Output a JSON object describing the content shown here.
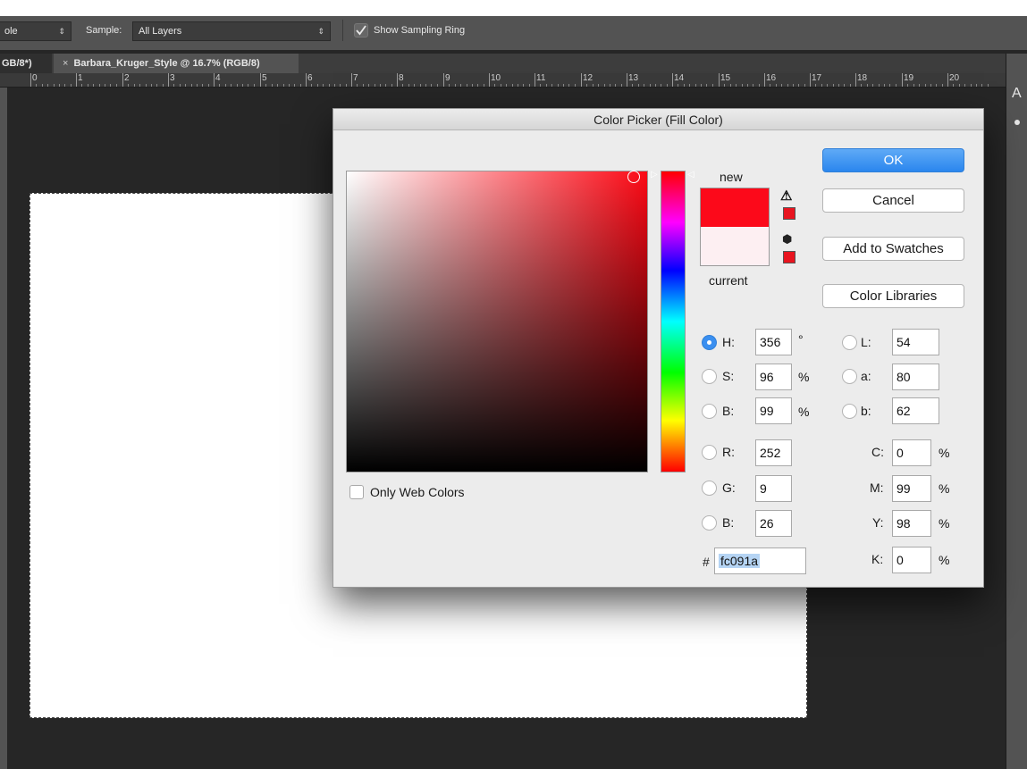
{
  "options_bar": {
    "tool_select": "ole",
    "sample_label": "Sample:",
    "sample_value": "All Layers",
    "show_sampling_ring": "Show Sampling Ring"
  },
  "tabs": [
    {
      "label": "GB/8*)"
    },
    {
      "label": "Barbara_Kruger_Style @ 16.7% (RGB/8)"
    }
  ],
  "ruler_numbers": [
    "0",
    "1",
    "2",
    "3",
    "4",
    "5",
    "6",
    "7",
    "8",
    "9",
    "10",
    "11",
    "12",
    "13",
    "14",
    "15",
    "16",
    "17",
    "18",
    "19",
    "20"
  ],
  "right_panel_letter": "A",
  "dialog": {
    "title": "Color Picker (Fill Color)",
    "new_label": "new",
    "current_label": "current",
    "colors": {
      "new": "#fc091a",
      "current": "#fdeff2"
    },
    "buttons": {
      "ok": "OK",
      "cancel": "Cancel",
      "add_to_swatches": "Add to Swatches",
      "color_libraries": "Color Libraries"
    },
    "hsb": {
      "h_label": "H:",
      "h_value": "356",
      "h_unit": "°",
      "s_label": "S:",
      "s_value": "96",
      "s_unit": "%",
      "b_label": "B:",
      "b_value": "99",
      "b_unit": "%"
    },
    "rgb": {
      "r_label": "R:",
      "r_value": "252",
      "g_label": "G:",
      "g_value": "9",
      "b_label": "B:",
      "b_value": "26"
    },
    "lab": {
      "l_label": "L:",
      "l_value": "54",
      "a_label": "a:",
      "a_value": "80",
      "b_label": "b:",
      "b_value": "62"
    },
    "cmyk": {
      "c_label": "C:",
      "c_value": "0",
      "m_label": "M:",
      "m_value": "99",
      "y_label": "Y:",
      "y_value": "98",
      "k_label": "K:",
      "k_value": "0",
      "unit": "%"
    },
    "hex_label": "#",
    "hex_value": "fc091a",
    "only_web_colors": "Only Web Colors"
  }
}
